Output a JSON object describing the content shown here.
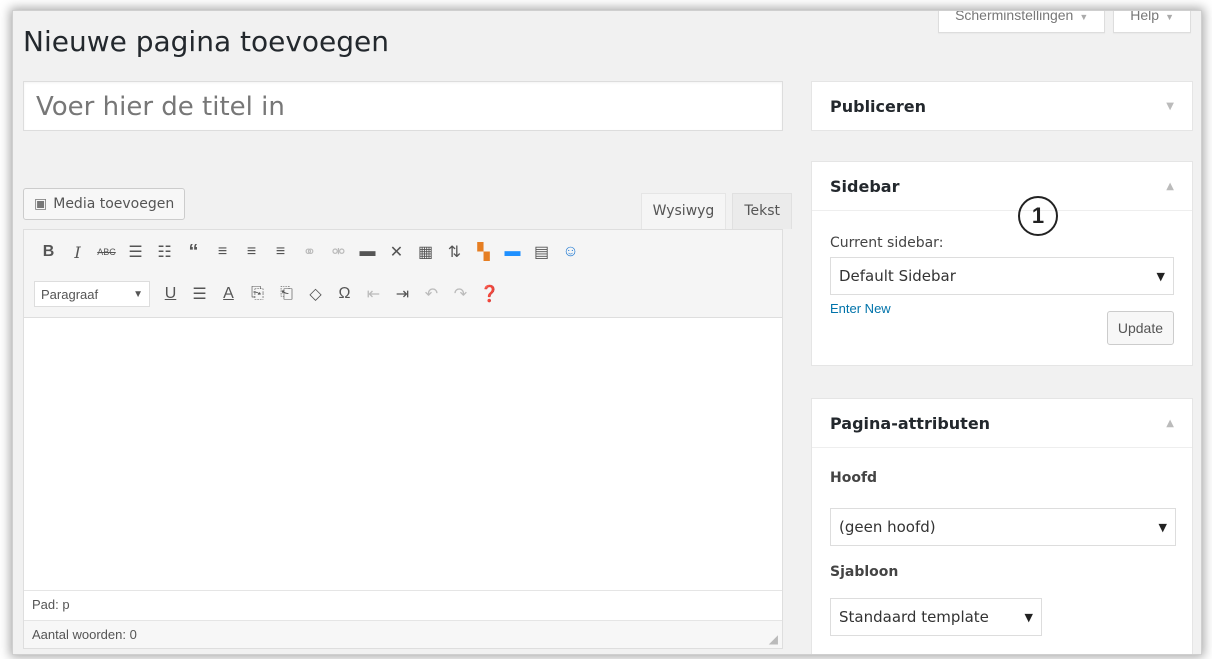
{
  "screen_options": {
    "label": "Scherminstellingen",
    "help": "Help"
  },
  "page_title": "Nieuwe pagina toevoegen",
  "title_placeholder": "Voer hier de titel in",
  "media_button": "Media toevoegen",
  "mode_tabs": {
    "visual": "Wysiwyg",
    "text": "Tekst"
  },
  "editor": {
    "format_select": "Paragraaf",
    "path": "Pad: p",
    "word_count": "Aantal woorden: 0"
  },
  "publish_box": {
    "title": "Publiceren"
  },
  "sidebar_box": {
    "title": "Sidebar",
    "current_label": "Current sidebar:",
    "selected": "Default Sidebar",
    "enter_new": "Enter New",
    "update": "Update"
  },
  "marker": "1",
  "attributes_box": {
    "title": "Pagina-attributen",
    "parent_label": "Hoofd",
    "parent_value": "(geen hoofd)",
    "template_label": "Sjabloon",
    "template_value": "Standaard template"
  }
}
